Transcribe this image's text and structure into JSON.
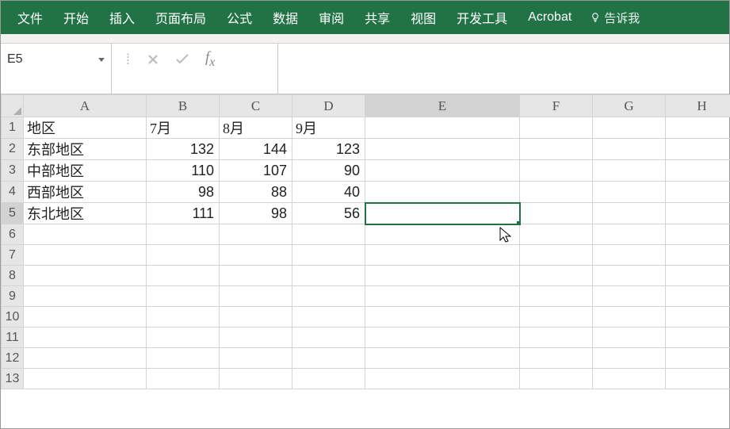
{
  "ribbon": {
    "tabs": [
      "文件",
      "开始",
      "插入",
      "页面布局",
      "公式",
      "数据",
      "审阅",
      "共享",
      "视图",
      "开发工具",
      "Acrobat"
    ],
    "tellme": "告诉我"
  },
  "namebox": {
    "value": "E5"
  },
  "formula": {
    "value": ""
  },
  "columns": [
    "A",
    "B",
    "C",
    "D",
    "E",
    "F",
    "G",
    "H"
  ],
  "rowCount": 13,
  "activeCell": {
    "row": 5,
    "col": "E"
  },
  "cells": {
    "A1": "地区",
    "B1": "7月",
    "C1": "8月",
    "D1": "9月",
    "A2": "东部地区",
    "B2": "132",
    "C2": "144",
    "D2": "123",
    "A3": "中部地区",
    "B3": "110",
    "C3": "107",
    "D3": "90",
    "A4": "西部地区",
    "B4": "98",
    "C4": "88",
    "D4": "40",
    "A5": "东北地区",
    "B5": "111",
    "C5": "98",
    "D5": "56"
  },
  "chart_data": {
    "type": "table",
    "categories_col": "地区",
    "series_cols": [
      "7月",
      "8月",
      "9月"
    ],
    "rows": [
      {
        "地区": "东部地区",
        "7月": 132,
        "8月": 144,
        "9月": 123
      },
      {
        "地区": "中部地区",
        "7月": 110,
        "8月": 107,
        "9月": 90
      },
      {
        "地区": "西部地区",
        "7月": 98,
        "8月": 88,
        "9月": 40
      },
      {
        "地区": "东北地区",
        "7月": 111,
        "8月": 98,
        "9月": 56
      }
    ]
  }
}
